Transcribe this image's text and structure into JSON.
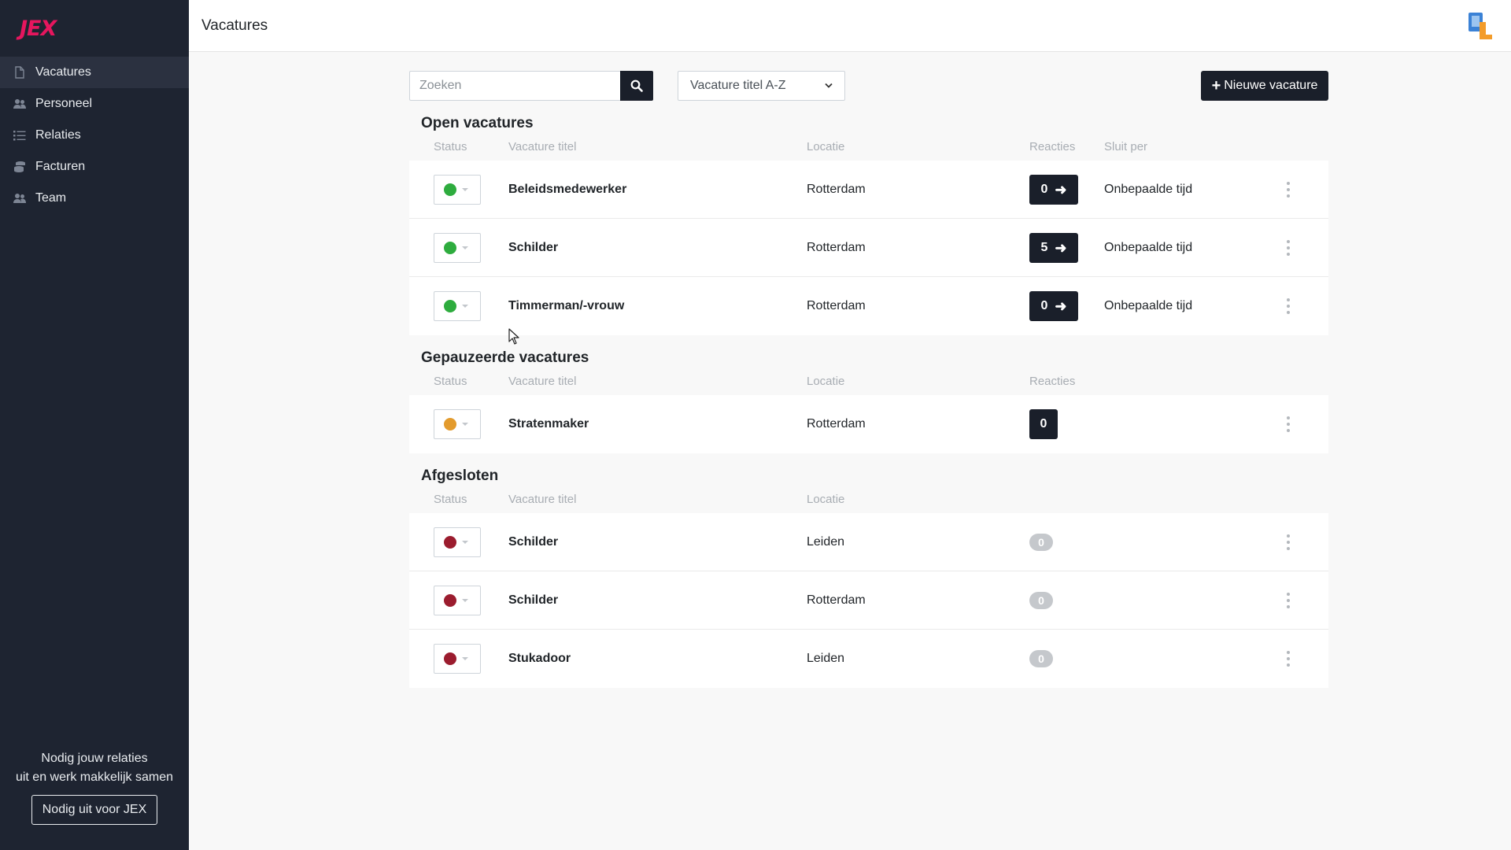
{
  "app": {
    "logo": "JEX",
    "brand_color": "#e6165e"
  },
  "sidebar": {
    "items": [
      {
        "label": "Vacatures",
        "icon": "file-icon",
        "active": true
      },
      {
        "label": "Personeel",
        "icon": "users-icon",
        "active": false
      },
      {
        "label": "Relaties",
        "icon": "list-icon",
        "active": false
      },
      {
        "label": "Facturen",
        "icon": "coins-icon",
        "active": false
      },
      {
        "label": "Team",
        "icon": "users-icon",
        "active": false
      }
    ],
    "invite_line1": "Nodig jouw relaties",
    "invite_line2": "uit en werk makkelijk samen",
    "invite_button": "Nodig uit voor JEX"
  },
  "header": {
    "title": "Vacatures"
  },
  "toolbar": {
    "search_placeholder": "Zoeken",
    "sort_value": "Vacature titel A-Z",
    "new_button": "Nieuwe vacature"
  },
  "columns": {
    "status": "Status",
    "title": "Vacature titel",
    "location": "Locatie",
    "reactions": "Reacties",
    "closes": "Sluit per"
  },
  "status_colors": {
    "open": "#2eac3e",
    "paused": "#e39b2d",
    "closed": "#9b1c2e"
  },
  "sections": {
    "open": {
      "title": "Open vacatures",
      "rows": [
        {
          "title": "Beleidsmedewerker",
          "location": "Rotterdam",
          "reactions": "0",
          "closes": "Onbepaalde tijd"
        },
        {
          "title": "Schilder",
          "location": "Rotterdam",
          "reactions": "5",
          "closes": "Onbepaalde tijd"
        },
        {
          "title": "Timmerman/-vrouw",
          "location": "Rotterdam",
          "reactions": "0",
          "closes": "Onbepaalde tijd"
        }
      ]
    },
    "paused": {
      "title": "Gepauzeerde vacatures",
      "rows": [
        {
          "title": "Stratenmaker",
          "location": "Rotterdam",
          "reactions": "0"
        }
      ]
    },
    "closed": {
      "title": "Afgesloten",
      "rows": [
        {
          "title": "Schilder",
          "location": "Leiden",
          "reactions": "0"
        },
        {
          "title": "Schilder",
          "location": "Rotterdam",
          "reactions": "0"
        },
        {
          "title": "Stukadoor",
          "location": "Leiden",
          "reactions": "0"
        }
      ]
    }
  }
}
